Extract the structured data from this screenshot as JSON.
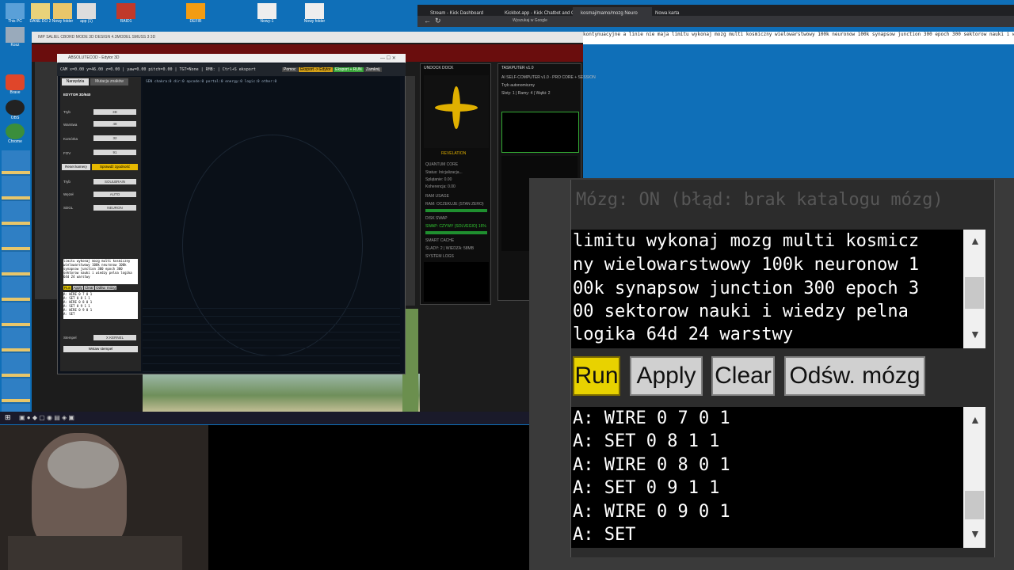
{
  "desktop": {
    "icons": [
      {
        "label": "This PC"
      },
      {
        "label": "DANE DO 2"
      },
      {
        "label": "Nowy folder"
      },
      {
        "label": "app (1)"
      },
      {
        "label": "RAID1"
      },
      {
        "label": "DEFIR"
      },
      {
        "label": "Nowy-1"
      },
      {
        "label": "Nowy folder"
      },
      {
        "label": "Kosz"
      },
      {
        "label": "Brave"
      },
      {
        "label": "OBS"
      },
      {
        "label": "Chrome"
      }
    ]
  },
  "browser": {
    "tabs": [
      "Stream - Kick Dashboard",
      "Kickbot.app - Kick Chatbot and Overlay",
      "kosmaj/mamo/mozg Neuro",
      "Nowa karta"
    ],
    "address": "Wyszukaj w Google"
  },
  "main_window": {
    "title": "IMP SALIEL CBORD MODE 3D DESIGN 4.3MODEL SMUSS 3 3D",
    "right_text": "kontynuacyjne a linie nie maja limitu wykonaj mozg multi kosmiczny wielowarstwowy 100k neuronow 100k synapsow junction 300 epoch 300 sektorow nauki i wiedzy pelna logika 64d 24 warstwy"
  },
  "editor": {
    "title": "ABSOLUTECOD - Edytor 3D",
    "toolbar": "CAM x=0.00 y=46.00 z=0.00 | yaw=0.00 pitch=0.00 | TGT=None | RMB: | Ctrl+S eksport",
    "toolbar_buttons": [
      "Pomoc",
      "Eksport -> Edytor",
      "Eksport + RUN",
      "Zamknij"
    ],
    "tabs": [
      "Narzędzia",
      "Mutacja znaków"
    ],
    "section": "EDYTOR 3D/640",
    "fields": [
      {
        "label": "Tryb",
        "value": "3D"
      },
      {
        "label": "Warstwa",
        "value": "48"
      },
      {
        "label": "Komórka",
        "value": "32"
      },
      {
        "label": "FOV",
        "value": "91"
      }
    ],
    "camera_buttons": [
      "Reset kamery",
      "Sprawdź zgodność"
    ],
    "selects": [
      {
        "label": "Tryb",
        "value": "SOULBRAIN"
      },
      {
        "label": "Węzeł",
        "value": "AUTO"
      },
      {
        "label": "SDGL",
        "value": "NEURON"
      }
    ],
    "canvas_header": "SEN  chakra:0  dir:0  opcode:0  portal:0  energy:0  logic:0  other:0",
    "prompt_small": "limitu wykonaj mozg multi kosmiczny wielowarstwowy 100k neuronow 100k synapsow junction 300 epoch 300 sektorow nauki i wiedzy pelna logika 64d 24 warstwy",
    "small_buttons": [
      "Run",
      "Apply",
      "Clear",
      "Odśw. mózg"
    ],
    "small_output": [
      "A: WIRE 0 7 0 1",
      "A: SET 0 8 1 1",
      "A: WIRE 0 8 0 1",
      "A: SET 0 9 1 1",
      "A: WIRE 0 9 0 1",
      "A: SET"
    ],
    "stamp_label": "Stempel",
    "stamp_value": "X KERNEL",
    "stamp_button": "Wstaw stempel"
  },
  "panel_cortex": {
    "title": "UNDOCK  DOCK",
    "logo_text": "REVELATION",
    "items": [
      "QUANTUM CORE",
      "Status: Inicjalizacja...",
      "Splątanie: 0.00",
      "Koherencja: 0.00",
      "RAM USAGE",
      "RAM: OCZEKUJE (STAN ZERO)",
      "DISK SWAP",
      "SWAP: CZYWY (SOLVEGIO) 16%",
      "SMART CACHE",
      "ŚLADY: 2 | WIEDZA: 58MB",
      "SYSTEM LOGS"
    ]
  },
  "panel_taskputer": {
    "title": "TASKPUTER v1.0",
    "lines": [
      "AI SELF-COMPUTER v1.0 - PRO CORE + SESSION",
      "Tryb autonomiczny",
      "Sloty: 1 | Ramy: 4 | Wątki: 2"
    ]
  },
  "right_panel": {
    "status": "Mózg: ON (błąd: brak katalogu mózg)",
    "prompt_lines": [
      "limitu wykonaj mozg multi kosmicz",
      "ny wielowarstwowy 100k neuronow 1",
      "00k synapsow junction 300 epoch 3",
      "00 sektorow nauki i wiedzy pelna",
      "logika 64d 24 warstwy"
    ],
    "buttons": {
      "run": "Run",
      "apply": "Apply",
      "clear": "Clear",
      "refresh": "Odśw. mózg"
    },
    "output_lines": [
      "A: WIRE 0 7 0 1",
      "A: SET 0 8 1 1",
      "A: WIRE 0 8 0 1",
      "A: SET 0 9 1 1",
      "A: WIRE 0 9 0 1",
      "A: SET"
    ],
    "colors": {
      "run_highlight": "#f3d400",
      "panel_bg": "#2c2c2c",
      "text_box": "#000000"
    }
  }
}
